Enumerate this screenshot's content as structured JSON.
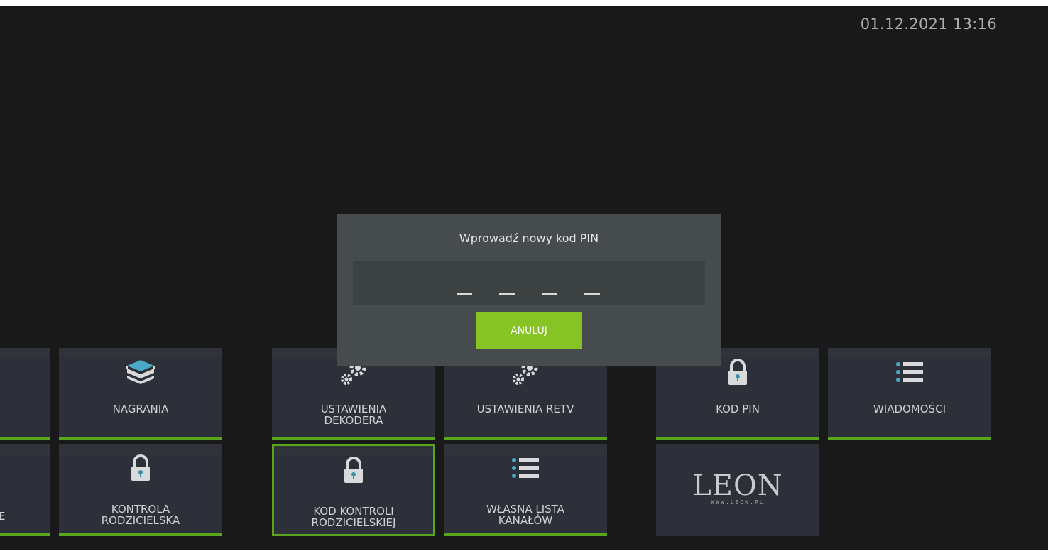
{
  "clock": "01.12.2021 13:16",
  "dialog": {
    "title": "Wprowadź nowy kod PIN",
    "pin_placeholder": [
      "_",
      "_",
      "_",
      "_"
    ],
    "cancel_label": "ANULUJ"
  },
  "tiles": {
    "nagrania": {
      "label": "NAGRANIA",
      "icon": "box-icon"
    },
    "ustawienia_dekodera": {
      "label": "USTAWIENIA\nDEKODERA",
      "icon": "gears-icon"
    },
    "ustawienia_retv": {
      "label": "USTAWIENIA RETV",
      "icon": "gears-icon"
    },
    "kod_pin": {
      "label": "KOD PIN",
      "icon": "padlock-icon"
    },
    "wiadomosci": {
      "label": "WIADOMOŚCI",
      "icon": "list-icon"
    },
    "partial_left_row2": {
      "label": "E"
    },
    "kontrola_rodzicielska": {
      "label": "KONTROLA\nRODZICIELSKA",
      "icon": "padlock-icon"
    },
    "kod_kontroli": {
      "label": "KOD KONTROLI\nRODZICIELSKIEJ",
      "icon": "padlock-icon"
    },
    "wlasna_lista": {
      "label": "WŁASNA LISTA\nKANAŁÓW",
      "icon": "list-icon"
    },
    "leon_logo": {
      "brand": "LEON",
      "url": "WWW.LEON.PL"
    }
  },
  "colors": {
    "background": "#191919",
    "tile": "#2d3038",
    "accent_green": "#5aa51a",
    "button_green": "#86c324",
    "dialog": "#464c4d"
  }
}
